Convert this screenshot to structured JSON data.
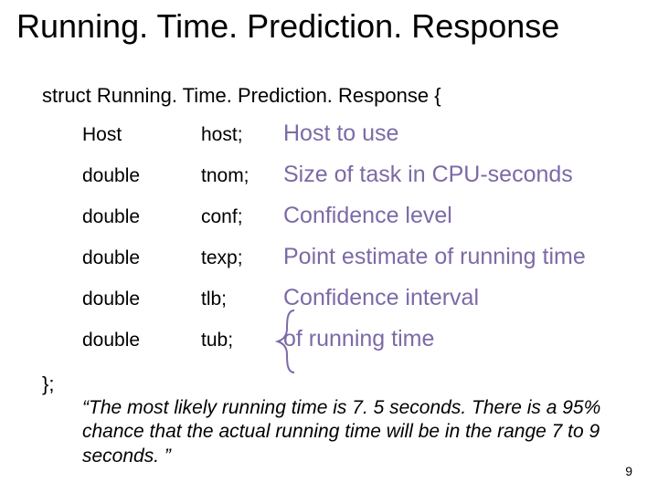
{
  "title": "Running. Time. Prediction. Response",
  "struct_open": "struct Running. Time. Prediction. Response {",
  "rows": [
    {
      "type": "Host",
      "name": "host;",
      "desc": "Host to use"
    },
    {
      "type": "double",
      "name": "tnom;",
      "desc": "Size of task in CPU-seconds"
    },
    {
      "type": "double",
      "name": "conf;",
      "desc": "Confidence level"
    },
    {
      "type": "double",
      "name": "texp;",
      "desc": "Point estimate of running time"
    },
    {
      "type": "double",
      "name": "tlb;",
      "desc": "Confidence interval"
    },
    {
      "type": "double",
      "name": "tub;",
      "desc": "of running time"
    }
  ],
  "struct_close": "};",
  "quote": "“The most likely running time is 7. 5 seconds.  There is a 95% chance that the actual running time will be in the range 7 to 9 seconds. ”",
  "page_number": "9"
}
